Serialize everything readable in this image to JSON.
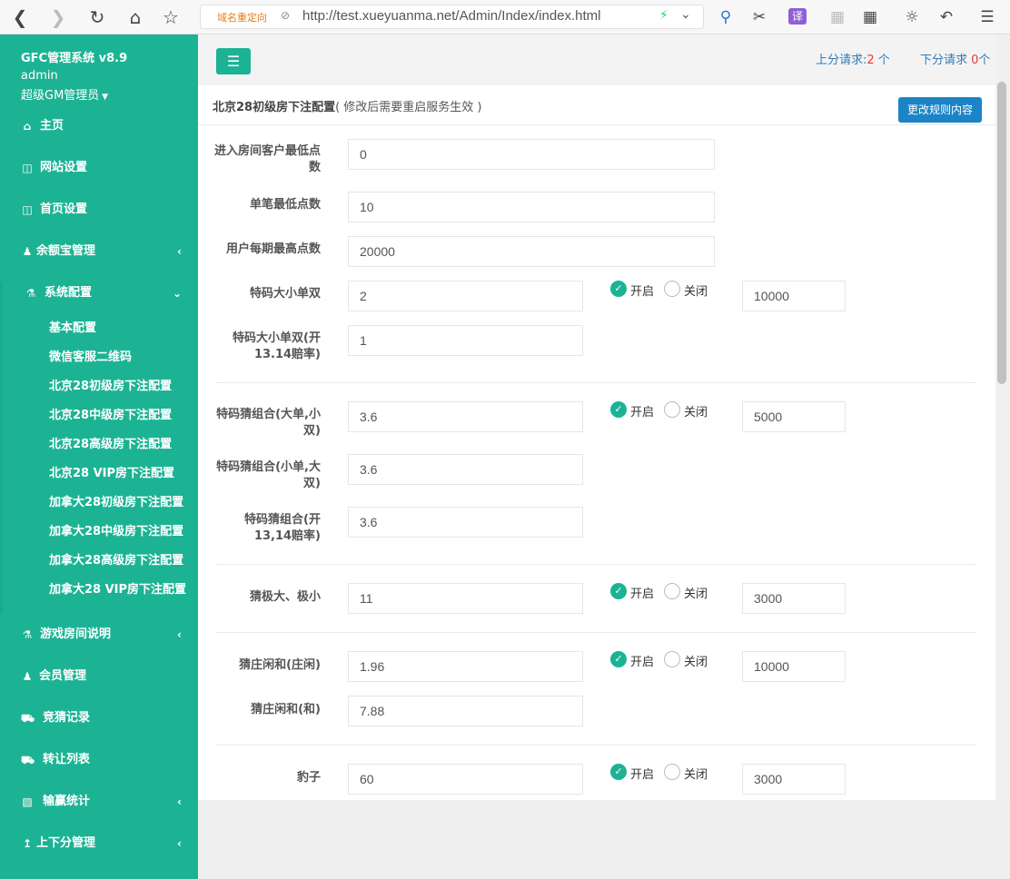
{
  "browser": {
    "redirect_tag": "域名重定向",
    "url": "http://test.xueyuanma.net/Admin/Index/index.html",
    "translate_label": "译"
  },
  "sidebar": {
    "brand": "GFC管理系统 v8.9",
    "user_name": "admin",
    "user_role": "超级GM管理员",
    "items": [
      {
        "label": "主页",
        "icon": "home-icon"
      },
      {
        "label": "网站设置",
        "icon": "columns-icon"
      },
      {
        "label": "首页设置",
        "icon": "columns-icon"
      },
      {
        "label": "余额宝管理",
        "icon": "person-icon"
      },
      {
        "label": "系统配置",
        "icon": "flask-icon"
      },
      {
        "label": "游戏房间说明",
        "icon": "flask-icon"
      },
      {
        "label": "会员管理",
        "icon": "user-icon"
      },
      {
        "label": "竞猜记录",
        "icon": "car-icon"
      },
      {
        "label": "转让列表",
        "icon": "car-icon"
      },
      {
        "label": "输赢统计",
        "icon": "bar-chart-icon"
      },
      {
        "label": "上下分管理",
        "icon": "arrow-up-icon"
      }
    ],
    "submenu": [
      "基本配置",
      "微信客服二维码",
      "北京28初级房下注配置",
      "北京28中级房下注配置",
      "北京28高级房下注配置",
      "北京28 VIP房下注配置",
      "加拿大28初级房下注配置",
      "加拿大28中级房下注配置",
      "加拿大28高级房下注配置",
      "加拿大28 VIP房下注配置"
    ]
  },
  "header": {
    "up_label": "上分请求:",
    "up_count": "2",
    "up_unit": " 个",
    "down_label": "下分请求 ",
    "down_count": "0",
    "down_unit": "个"
  },
  "panel": {
    "title": "北京28初级房下注配置",
    "note": "( 修改后需要重启服务生效 )",
    "rule_button": "更改规则内容"
  },
  "radio": {
    "on_label": "开启",
    "off_label": "关闭"
  },
  "fields": {
    "min_enter": {
      "label": "进入房间客户最低点数",
      "value": "0"
    },
    "min_bet": {
      "label": "单笔最低点数",
      "value": "10"
    },
    "max_per_period": {
      "label": "用户每期最高点数",
      "value": "20000"
    },
    "tema_dxds": {
      "label": "特码大小单双",
      "value": "2",
      "limit": "10000",
      "enabled": true
    },
    "tema_dxds_1314": {
      "label": "特码大小单双(开13.14赔率)",
      "value": "1"
    },
    "combo_big": {
      "label": "特码猜组合(大单,小双)",
      "value": "3.6",
      "limit": "5000",
      "enabled": true
    },
    "combo_small": {
      "label": "特码猜组合(小单,大双)",
      "value": "3.6"
    },
    "combo_1314": {
      "label": "特码猜组合(开13,14赔率)",
      "value": "3.6"
    },
    "extreme": {
      "label": "猜极大、极小",
      "value": "11",
      "limit": "3000",
      "enabled": true
    },
    "banker_player": {
      "label": "猜庄闲和(庄闲)",
      "value": "1.96",
      "limit": "10000",
      "enabled": true
    },
    "tie": {
      "label": "猜庄闲和(和)",
      "value": "7.88"
    },
    "leopard": {
      "label": "豹子",
      "value": "60",
      "limit": "3000",
      "enabled": true
    }
  }
}
